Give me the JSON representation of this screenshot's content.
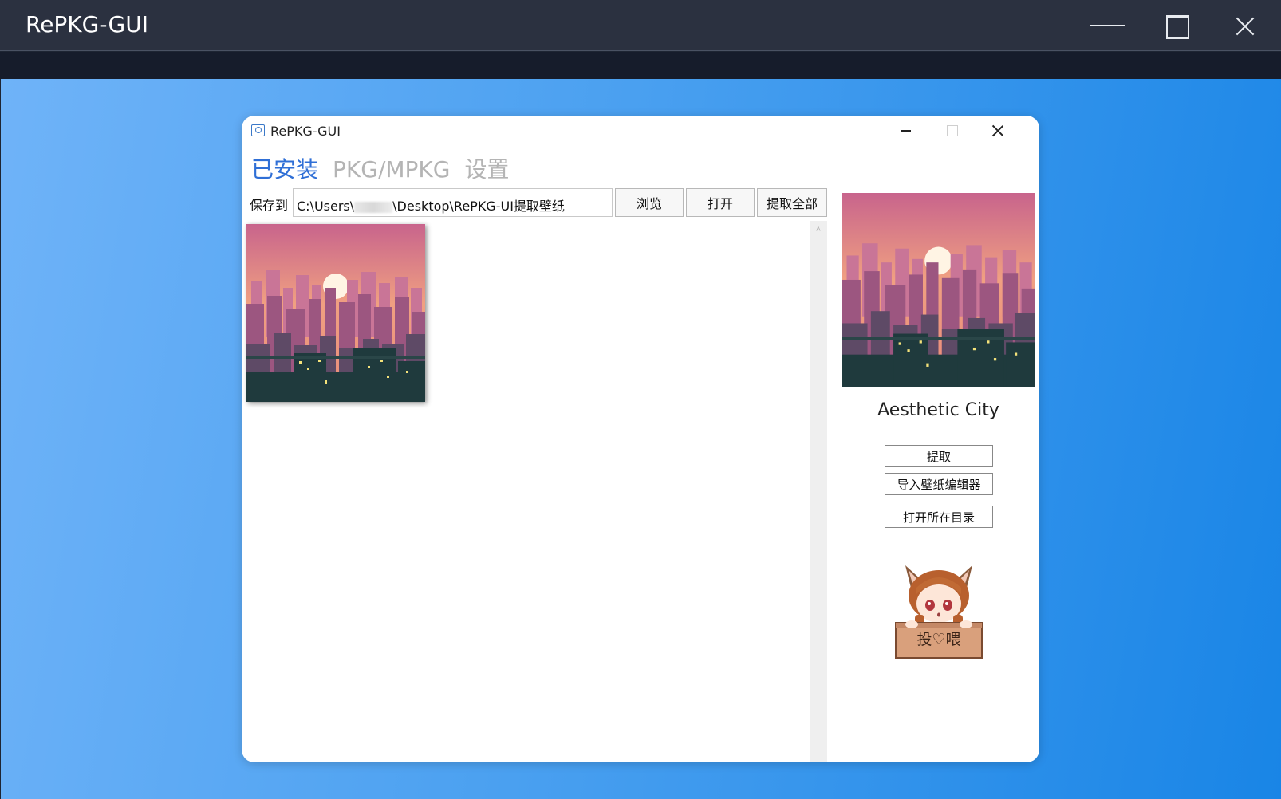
{
  "host": {
    "title": "RePKG-GUI",
    "controls": [
      "minimize",
      "maximize",
      "close"
    ]
  },
  "app": {
    "title": "RePKG-GUI",
    "tabs": [
      {
        "label": "已安装",
        "active": true
      },
      {
        "label": "PKG/MPKG",
        "active": false
      },
      {
        "label": "设置",
        "active": false
      }
    ],
    "toolbar": {
      "save_to_label": "保存到",
      "path_prefix": "C:\\Users\\",
      "path_suffix": "\\Desktop\\RePKG-UI提取壁纸",
      "browse_label": "浏览",
      "open_label": "打开",
      "extract_all_label": "提取全部"
    },
    "wallpapers": [
      {
        "name": "Aesthetic City",
        "selected": true
      }
    ],
    "details": {
      "name": "Aesthetic City",
      "extract_label": "提取",
      "import_label": "导入壁纸编辑器",
      "open_dir_label": "打开所在目录"
    },
    "donate": {
      "label": "投♡喂"
    }
  },
  "colors": {
    "accent": "#2f6fd6",
    "tab_inactive": "#b4b4b4",
    "host_titlebar": "#2b3140",
    "desktop_from": "#6fb3f8",
    "desktop_to": "#1985e6"
  }
}
